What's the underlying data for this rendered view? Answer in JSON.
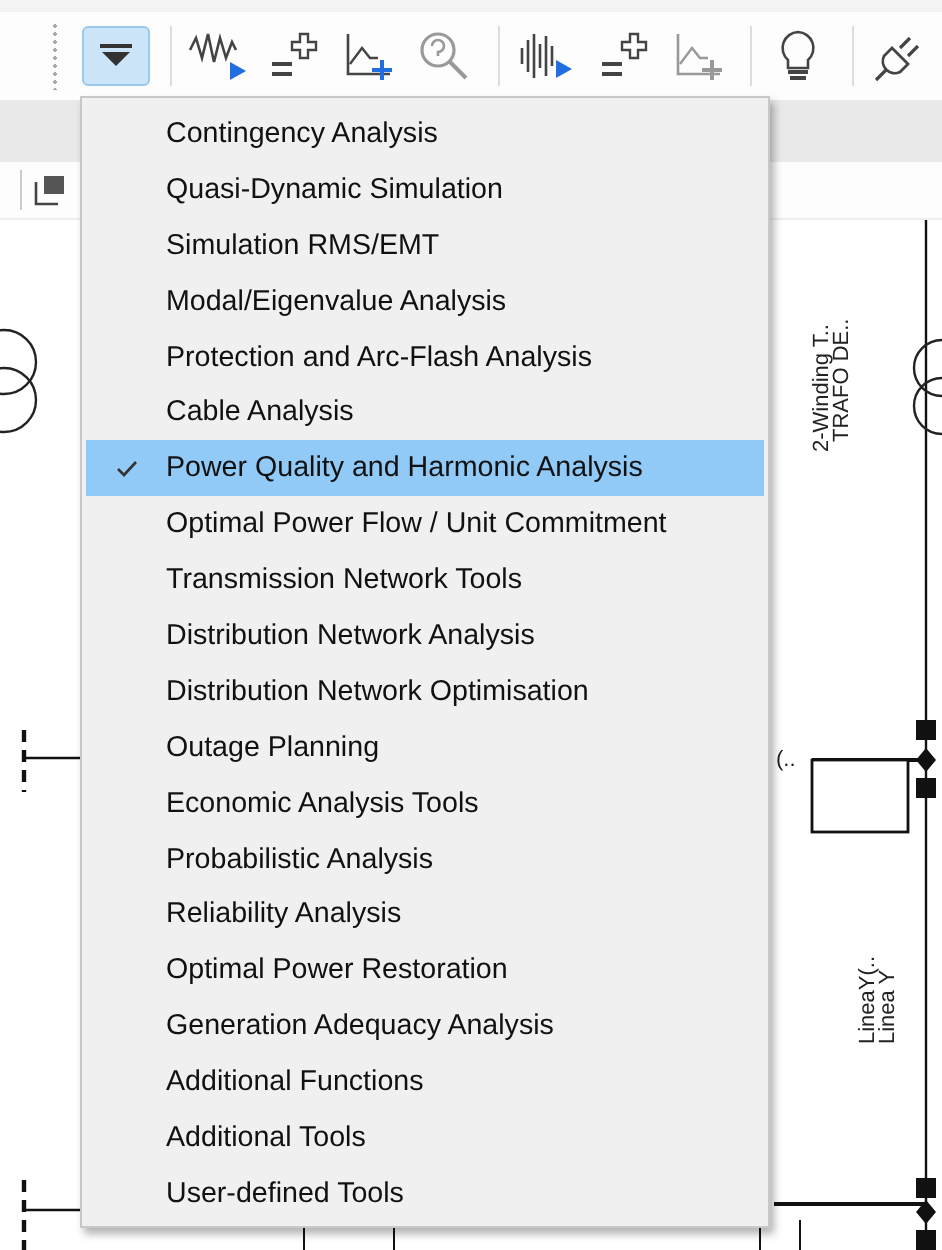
{
  "toolbar": {
    "menu_button": {
      "pressed": true
    }
  },
  "menu": {
    "items": [
      {
        "label": "Contingency Analysis",
        "checked": false,
        "selected": false
      },
      {
        "label": "Quasi-Dynamic Simulation",
        "checked": false,
        "selected": false
      },
      {
        "label": "Simulation RMS/EMT",
        "checked": false,
        "selected": false
      },
      {
        "label": "Modal/Eigenvalue Analysis",
        "checked": false,
        "selected": false
      },
      {
        "label": "Protection and Arc-Flash Analysis",
        "checked": false,
        "selected": false
      },
      {
        "label": "Cable Analysis",
        "checked": false,
        "selected": false
      },
      {
        "label": "Power Quality and Harmonic Analysis",
        "checked": true,
        "selected": true
      },
      {
        "label": "Optimal Power Flow / Unit Commitment",
        "checked": false,
        "selected": false
      },
      {
        "label": "Transmission Network Tools",
        "checked": false,
        "selected": false
      },
      {
        "label": "Distribution Network Analysis",
        "checked": false,
        "selected": false
      },
      {
        "label": "Distribution Network Optimisation",
        "checked": false,
        "selected": false
      },
      {
        "label": "Outage Planning",
        "checked": false,
        "selected": false
      },
      {
        "label": "Economic Analysis Tools",
        "checked": false,
        "selected": false
      },
      {
        "label": "Probabilistic Analysis",
        "checked": false,
        "selected": false
      },
      {
        "label": "Reliability Analysis",
        "checked": false,
        "selected": false
      },
      {
        "label": "Optimal Power Restoration",
        "checked": false,
        "selected": false
      },
      {
        "label": "Generation Adequacy Analysis",
        "checked": false,
        "selected": false
      },
      {
        "label": "Additional Functions",
        "checked": false,
        "selected": false
      },
      {
        "label": "Additional Tools",
        "checked": false,
        "selected": false
      },
      {
        "label": "User-defined Tools",
        "checked": false,
        "selected": false
      }
    ]
  },
  "diagram": {
    "labels": [
      "2-Winding T..",
      "TRAFO DE..",
      "(..",
      "LineaY(..",
      "Linea Y"
    ]
  }
}
